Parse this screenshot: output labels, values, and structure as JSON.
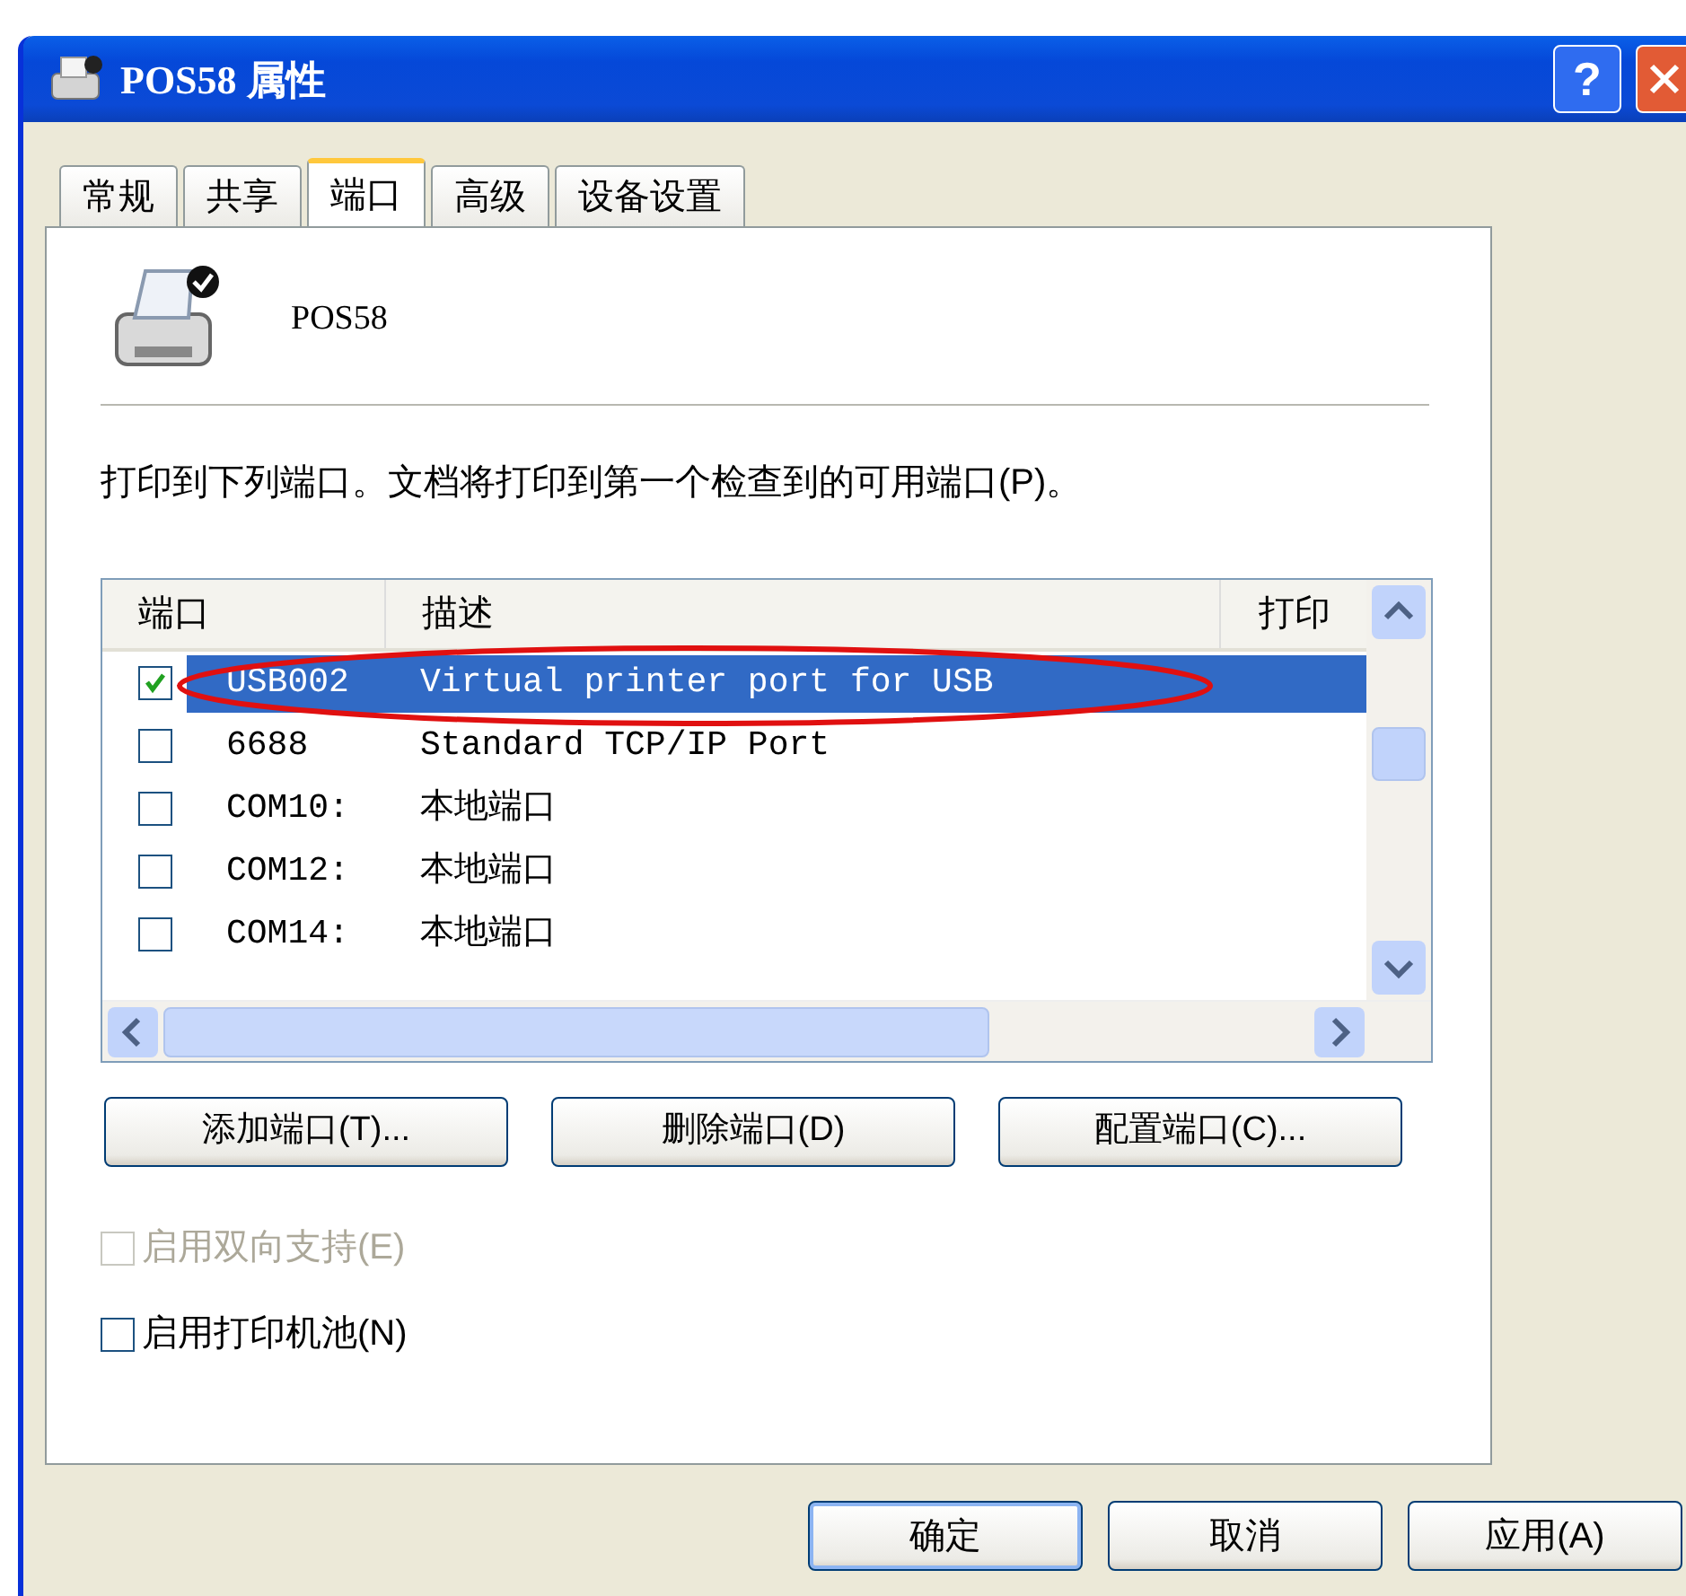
{
  "window": {
    "title": "POS58 属性",
    "help": "?"
  },
  "tabs": [
    {
      "label": "常规",
      "selected": false
    },
    {
      "label": "共享",
      "selected": false
    },
    {
      "label": "端口",
      "selected": true
    },
    {
      "label": "高级",
      "selected": false
    },
    {
      "label": "设备设置",
      "selected": false
    }
  ],
  "printer_name": "POS58",
  "instruction": "打印到下列端口。文档将打印到第一个检查到的可用端口(P)。",
  "ports": {
    "columns": [
      "端口",
      "描述",
      "打印"
    ],
    "rows": [
      {
        "port": "USB002",
        "description": "Virtual printer port for USB",
        "checked": true,
        "selected": true
      },
      {
        "port": "6688",
        "description": "Standard TCP/IP Port",
        "checked": false,
        "selected": false
      },
      {
        "port": "COM10:",
        "description": "本地端口",
        "checked": false,
        "selected": false
      },
      {
        "port": "COM12:",
        "description": "本地端口",
        "checked": false,
        "selected": false
      },
      {
        "port": "COM14:",
        "description": "本地端口",
        "checked": false,
        "selected": false
      }
    ]
  },
  "port_buttons": [
    "添加端口(T)...",
    "删除端口(D)",
    "配置端口(C)..."
  ],
  "options": [
    {
      "label": "启用双向支持(E)",
      "checked": false,
      "disabled": true
    },
    {
      "label": "启用打印机池(N)",
      "checked": false,
      "disabled": false
    }
  ],
  "dialog_buttons": [
    {
      "label": "确定",
      "default": true
    },
    {
      "label": "取消",
      "default": false
    },
    {
      "label": "应用(A)",
      "default": false
    }
  ]
}
